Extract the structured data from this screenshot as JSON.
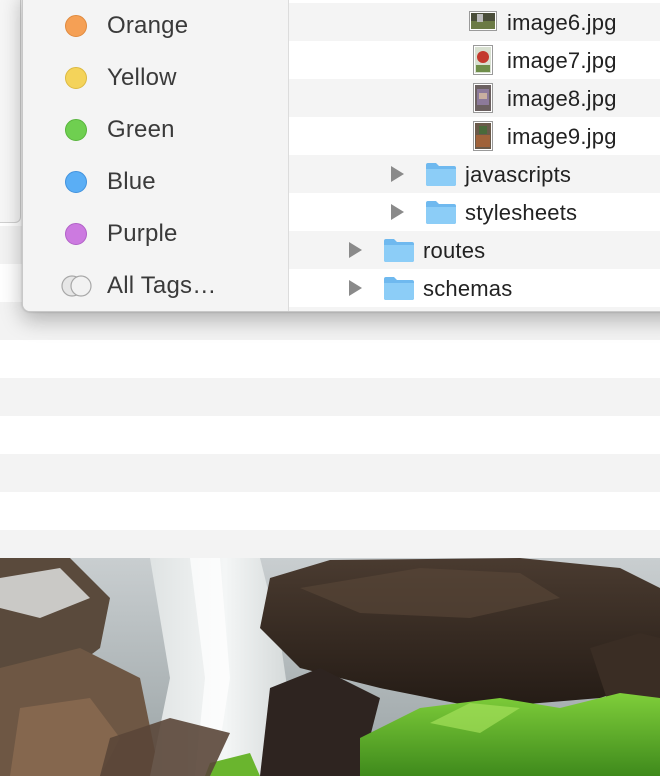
{
  "tags": {
    "items": [
      {
        "label": "Orange",
        "color": "#f5a055"
      },
      {
        "label": "Yellow",
        "color": "#f4d35a"
      },
      {
        "label": "Green",
        "color": "#6fcf50"
      },
      {
        "label": "Blue",
        "color": "#5aaef5"
      },
      {
        "label": "Purple",
        "color": "#cc7ae0"
      },
      {
        "label": "All Tags…",
        "color": "#d8d8d8"
      }
    ]
  },
  "files": {
    "rows": [
      {
        "name": "image6.jpg",
        "type": "image",
        "icon": "landscape-thumbnail-icon"
      },
      {
        "name": "image7.jpg",
        "type": "image",
        "icon": "portrait-thumbnail-icon"
      },
      {
        "name": "image8.jpg",
        "type": "image",
        "icon": "portrait-thumbnail-icon"
      },
      {
        "name": "image9.jpg",
        "type": "image",
        "icon": "portrait-thumbnail-icon"
      },
      {
        "name": "javascripts",
        "type": "folder",
        "icon": "folder-icon",
        "expanded": false
      },
      {
        "name": "stylesheets",
        "type": "folder",
        "icon": "folder-icon",
        "expanded": false
      },
      {
        "name": "routes",
        "type": "folder",
        "icon": "folder-icon",
        "expanded": false
      },
      {
        "name": "schemas",
        "type": "folder",
        "icon": "folder-icon",
        "expanded": false
      }
    ]
  },
  "colors": {
    "folder": "#7cc4f5",
    "disclosure": "#8a8a8a",
    "row_alt": "#f4f4f4",
    "sidebar_bg": "#f4f4f4"
  }
}
